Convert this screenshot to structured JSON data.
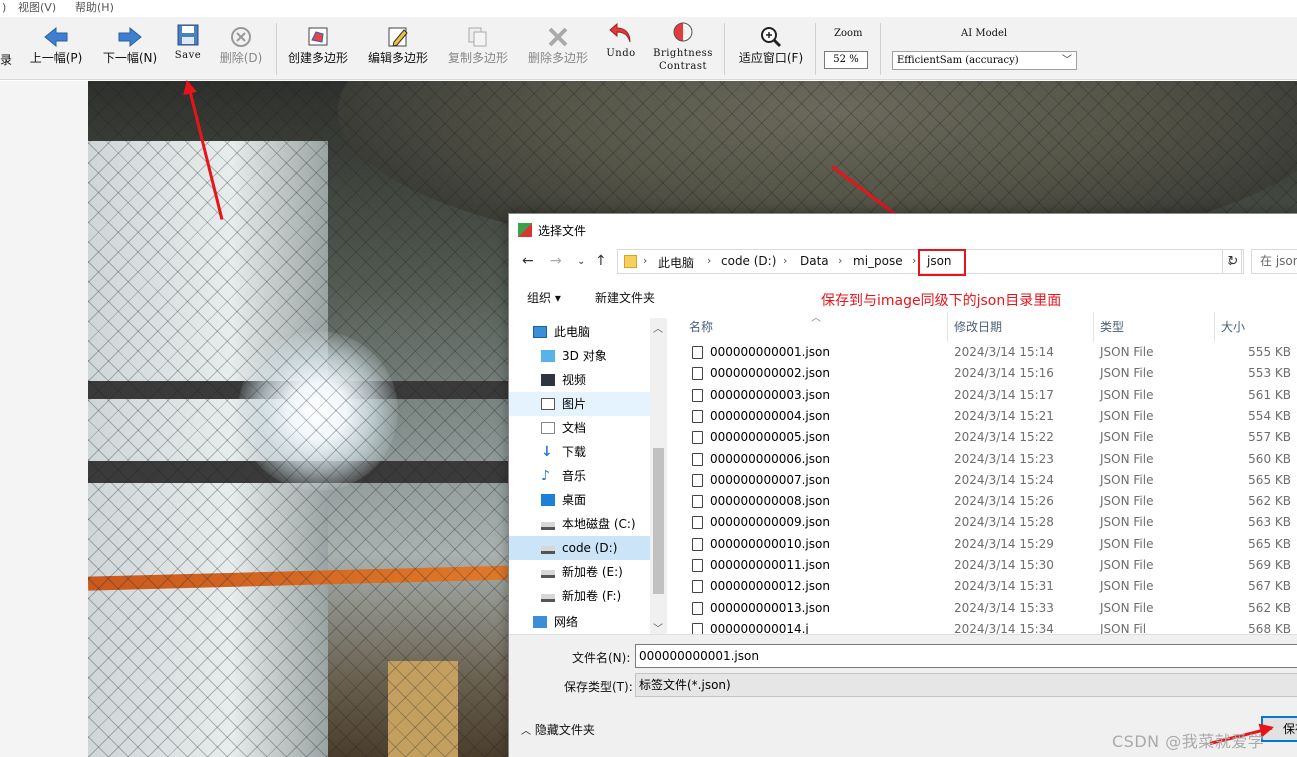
{
  "menubar": {
    "left_fragment": ")",
    "view": "视图(V)",
    "help": "帮助(H)"
  },
  "toolbar": {
    "dir_fragment": "录",
    "prev": "上一幅(P)",
    "next": "下一幅(N)",
    "save": "Save",
    "delete": "删除(D)",
    "create_polygon": "创建多边形",
    "edit_polygon": "编辑多边形",
    "copy_polygon": "复制多边形",
    "delete_polygon": "删除多边形",
    "undo": "Undo",
    "brightness": "Brightness",
    "contrast": "Contrast",
    "fit_window": "适应窗口(F)",
    "zoom_title": "Zoom",
    "zoom_value": "52 %",
    "ai_title": "AI Model",
    "ai_model": "EfficientSam (accuracy)"
  },
  "dialog": {
    "title": "选择文件",
    "breadcrumb": [
      "此电脑",
      "code (D:)",
      "Data",
      "mi_pose",
      "json"
    ],
    "search_placeholder": "在 json",
    "organize": "组织 ▾",
    "new_folder": "新建文件夹",
    "annotation": "保存到与image同级下的json目录里面",
    "tree": [
      {
        "label": "此电脑",
        "icon": "computer"
      },
      {
        "label": "3D 对象",
        "icon": "cube"
      },
      {
        "label": "视频",
        "icon": "video"
      },
      {
        "label": "图片",
        "icon": "picture"
      },
      {
        "label": "文档",
        "icon": "document"
      },
      {
        "label": "下载",
        "icon": "download"
      },
      {
        "label": "音乐",
        "icon": "music"
      },
      {
        "label": "桌面",
        "icon": "desktop"
      },
      {
        "label": "本地磁盘 (C:)",
        "icon": "drive"
      },
      {
        "label": "code (D:)",
        "icon": "drive"
      },
      {
        "label": "新加卷 (E:)",
        "icon": "drive"
      },
      {
        "label": "新加卷 (F:)",
        "icon": "drive"
      },
      {
        "label": "网络",
        "icon": "network"
      }
    ],
    "columns": {
      "name": "名称",
      "date": "修改日期",
      "type": "类型",
      "size": "大小"
    },
    "files": [
      {
        "name": "000000000001.json",
        "date": "2024/3/14 15:14",
        "type": "JSON File",
        "size": "555 KB"
      },
      {
        "name": "000000000002.json",
        "date": "2024/3/14 15:16",
        "type": "JSON File",
        "size": "553 KB"
      },
      {
        "name": "000000000003.json",
        "date": "2024/3/14 15:17",
        "type": "JSON File",
        "size": "561 KB"
      },
      {
        "name": "000000000004.json",
        "date": "2024/3/14 15:21",
        "type": "JSON File",
        "size": "554 KB"
      },
      {
        "name": "000000000005.json",
        "date": "2024/3/14 15:22",
        "type": "JSON File",
        "size": "557 KB"
      },
      {
        "name": "000000000006.json",
        "date": "2024/3/14 15:23",
        "type": "JSON File",
        "size": "560 KB"
      },
      {
        "name": "000000000007.json",
        "date": "2024/3/14 15:24",
        "type": "JSON File",
        "size": "565 KB"
      },
      {
        "name": "000000000008.json",
        "date": "2024/3/14 15:26",
        "type": "JSON File",
        "size": "562 KB"
      },
      {
        "name": "000000000009.json",
        "date": "2024/3/14 15:28",
        "type": "JSON File",
        "size": "563 KB"
      },
      {
        "name": "000000000010.json",
        "date": "2024/3/14 15:29",
        "type": "JSON File",
        "size": "565 KB"
      },
      {
        "name": "000000000011.json",
        "date": "2024/3/14 15:30",
        "type": "JSON File",
        "size": "569 KB"
      },
      {
        "name": "000000000012.json",
        "date": "2024/3/14 15:31",
        "type": "JSON File",
        "size": "567 KB"
      },
      {
        "name": "000000000013.json",
        "date": "2024/3/14 15:33",
        "type": "JSON File",
        "size": "562 KB"
      },
      {
        "name": "000000000014.j",
        "date": "2024/3/14 15:34",
        "type": "JSON Fil",
        "size": "568 KB"
      }
    ],
    "filename_label": "文件名(N):",
    "filename_value": "000000000001.json",
    "filetype_label": "保存类型(T):",
    "filetype_value": "标签文件(*.json)",
    "hide_folders": "隐藏文件夹",
    "save_button": "保存"
  },
  "watermark": "CSDN @我菜就爱学",
  "colors": {
    "annotation_red": "#e8141a",
    "selection_blue": "#cce4f7",
    "accent": "#0078d7"
  }
}
